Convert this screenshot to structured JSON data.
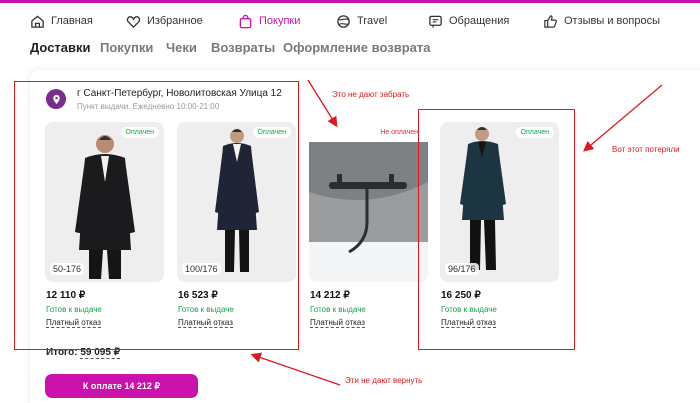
{
  "nav": {
    "items": [
      {
        "label": "Главная",
        "icon": "home-icon"
      },
      {
        "label": "Избранное",
        "icon": "heart-icon"
      },
      {
        "label": "Покупки",
        "icon": "shopping-bag-icon"
      },
      {
        "label": "Travel",
        "icon": "globe-icon"
      },
      {
        "label": "Обращения",
        "icon": "chat-icon"
      },
      {
        "label": "Отзывы и вопросы",
        "icon": "thumbs-up-icon"
      }
    ],
    "active": "Покупки"
  },
  "tabs": [
    "Доставки",
    "Покупки",
    "Чеки",
    "Возвраты",
    "Оформление возврата"
  ],
  "pickup": {
    "address": "г Санкт-Петербург, Новолитовская Улица 12",
    "hours": "Пункт выдачи. Ежедневно 10:00-21:00"
  },
  "products": [
    {
      "badge": "Оплачен",
      "paid": true,
      "size": "50-176",
      "price": "12 110 ₽",
      "status": "Готов к выдаче",
      "refuse": "Платный отказ"
    },
    {
      "badge": "Оплачен",
      "paid": true,
      "size": "100/176",
      "price": "16 523 ₽",
      "status": "Готов к выдаче",
      "refuse": "Платный отказ"
    },
    {
      "badge": "Не оплачен",
      "paid": false,
      "size": "",
      "price": "14 212 ₽",
      "status": "Готов к выдаче",
      "refuse": "Платный отказ"
    },
    {
      "badge": "Оплачен",
      "paid": true,
      "size": "96/176",
      "price": "16 250 ₽",
      "status": "Готов к выдаче",
      "refuse": "Платный отказ"
    }
  ],
  "total": {
    "label": "Итого:",
    "value": "59 095 ₽"
  },
  "pay_button": "К оплате 14 212 ₽",
  "annotations": {
    "cant_take": "Это не дают забрать",
    "lost": "Вот этот потеряли",
    "cant_return": "Эти не дают вернуть",
    "color": "#e0171d"
  },
  "colors": {
    "brand": "#cb11ab",
    "paid": "#12a34a",
    "unpaid": "#e5283e"
  }
}
